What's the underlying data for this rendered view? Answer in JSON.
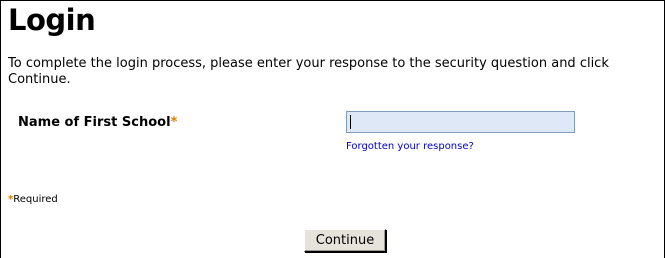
{
  "page": {
    "title": "Login",
    "instructions": "To complete the login process, please enter your response to the security question and click Continue."
  },
  "form": {
    "security_question_label": "Name of First School",
    "required_marker": "*",
    "answer_value": "",
    "forgot_link": "Forgotten your response?",
    "required_note_marker": "*",
    "required_note": "Required",
    "continue_label": "Continue"
  },
  "colors": {
    "required_star": "#e07b00",
    "link": "#0000cc",
    "input_background": "#dfe8f6"
  }
}
